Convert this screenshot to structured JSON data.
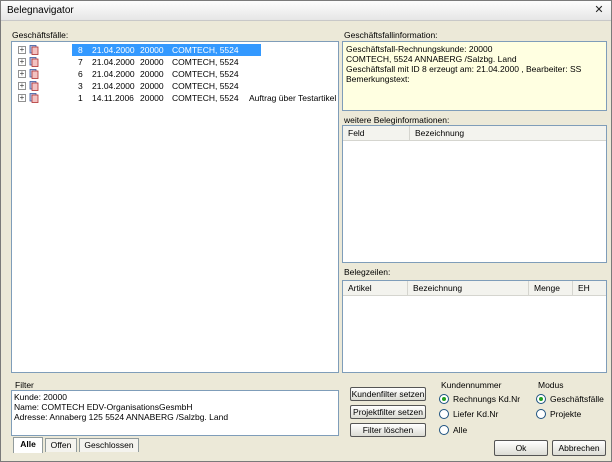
{
  "window": {
    "title": "Belegnavigator",
    "close_glyph": "✕"
  },
  "cases": {
    "label": "Geschäftsfälle:",
    "rows": [
      {
        "num": "8",
        "date": "21.04.2000",
        "code": "20000",
        "name": "COMTECH, 5524",
        "note": "",
        "selected": true
      },
      {
        "num": "7",
        "date": "21.04.2000",
        "code": "20000",
        "name": "COMTECH, 5524",
        "note": "",
        "selected": false
      },
      {
        "num": "6",
        "date": "21.04.2000",
        "code": "20000",
        "name": "COMTECH, 5524",
        "note": "",
        "selected": false
      },
      {
        "num": "3",
        "date": "21.04.2000",
        "code": "20000",
        "name": "COMTECH, 5524",
        "note": "",
        "selected": false
      },
      {
        "num": "1",
        "date": "14.11.2006",
        "code": "20000",
        "name": "COMTECH, 5524",
        "note": "Auftrag über Testartikel",
        "selected": false
      }
    ],
    "expand_glyph": "+",
    "row_icon": "document-stack-icon"
  },
  "info": {
    "label": "Geschäftsfallinformation:",
    "lines": [
      "Geschäftsfall-Rechnungskunde: 20000",
      "COMTECH, 5524 ANNABERG /Salzbg. Land",
      "Geschäftsfall mit ID 8 erzeugt am: 21.04.2000 , Bearbeiter: SS",
      "Bemerkungstext:"
    ]
  },
  "more_info": {
    "label": "weitere Beleginformationen:",
    "columns": [
      "Feld",
      "Bezeichnung"
    ]
  },
  "lines_panel": {
    "label": "Belegzeilen:",
    "columns": [
      "Artikel",
      "Bezeichnung",
      "Menge",
      "EH"
    ]
  },
  "filter": {
    "label": "Filter",
    "lines": [
      "Kunde: 20000",
      "Name: COMTECH EDV-OrganisationsGesmbH",
      "Adresse: Annaberg 125 5524 ANNABERG /Salzbg. Land"
    ],
    "buttons": {
      "customer": "Kundenfilter setzen",
      "project": "Projektfilter setzen",
      "clear": "Filter löschen"
    }
  },
  "customer_number": {
    "label": "Kundennummer",
    "options": [
      {
        "label": "Rechnungs Kd.Nr",
        "selected": true
      },
      {
        "label": "Liefer Kd.Nr",
        "selected": false
      },
      {
        "label": "Alle",
        "selected": false
      }
    ]
  },
  "mode": {
    "label": "Modus",
    "options": [
      {
        "label": "Geschäftsfälle",
        "selected": true
      },
      {
        "label": "Projekte",
        "selected": false
      }
    ]
  },
  "tabs": [
    {
      "label": "Alle",
      "active": true
    },
    {
      "label": "Offen",
      "active": false
    },
    {
      "label": "Geschlossen",
      "active": false
    }
  ],
  "dialog_buttons": {
    "ok": "Ok",
    "cancel": "Abbrechen"
  },
  "colors": {
    "selection": "#3399ff",
    "info_bg": "#ffffe1",
    "panel_border": "#7f9db9",
    "dialog_bg": "#ece9d8"
  }
}
